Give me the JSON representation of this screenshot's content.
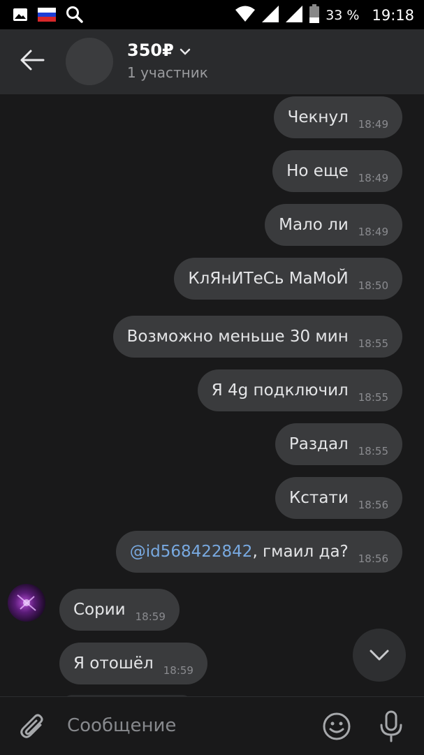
{
  "status_bar": {
    "battery": "33 %",
    "time": "19:18",
    "icons": [
      "gallery-icon",
      "russia-flag-icon",
      "search-icon",
      "wifi-icon",
      "signal-icon",
      "signal-icon-2",
      "battery-icon"
    ]
  },
  "header": {
    "title": "350₽",
    "subtitle": "1 участник"
  },
  "messages": [
    {
      "text": "Чекнул",
      "time": "18:49",
      "direction": "out"
    },
    {
      "text": "Но еще",
      "time": "18:49",
      "direction": "out"
    },
    {
      "text": "Мало ли",
      "time": "18:49",
      "direction": "out"
    },
    {
      "text": "КлЯнИТеСь МаМоЙ",
      "time": "18:50",
      "direction": "out"
    },
    {
      "text": "Возможно меньше 30 мин",
      "time": "18:55",
      "direction": "out"
    },
    {
      "text": "Я 4g подключил",
      "time": "18:55",
      "direction": "out"
    },
    {
      "text": "Раздал",
      "time": "18:55",
      "direction": "out"
    },
    {
      "text": "Кстати",
      "time": "18:56",
      "direction": "out"
    },
    {
      "mention": "@id568422842",
      "text": ", гмаил да?",
      "time": "18:56",
      "direction": "out"
    },
    {
      "text": "Сории",
      "time": "18:59",
      "direction": "in"
    },
    {
      "text": "Я отошёл",
      "time": "18:59",
      "direction": "in"
    }
  ],
  "composer": {
    "placeholder": "Сообщение"
  },
  "colors": {
    "background": "#19191a",
    "header": "#2a2b2d",
    "bubble": "#3a3b3d",
    "mention": "#78a9e0"
  }
}
